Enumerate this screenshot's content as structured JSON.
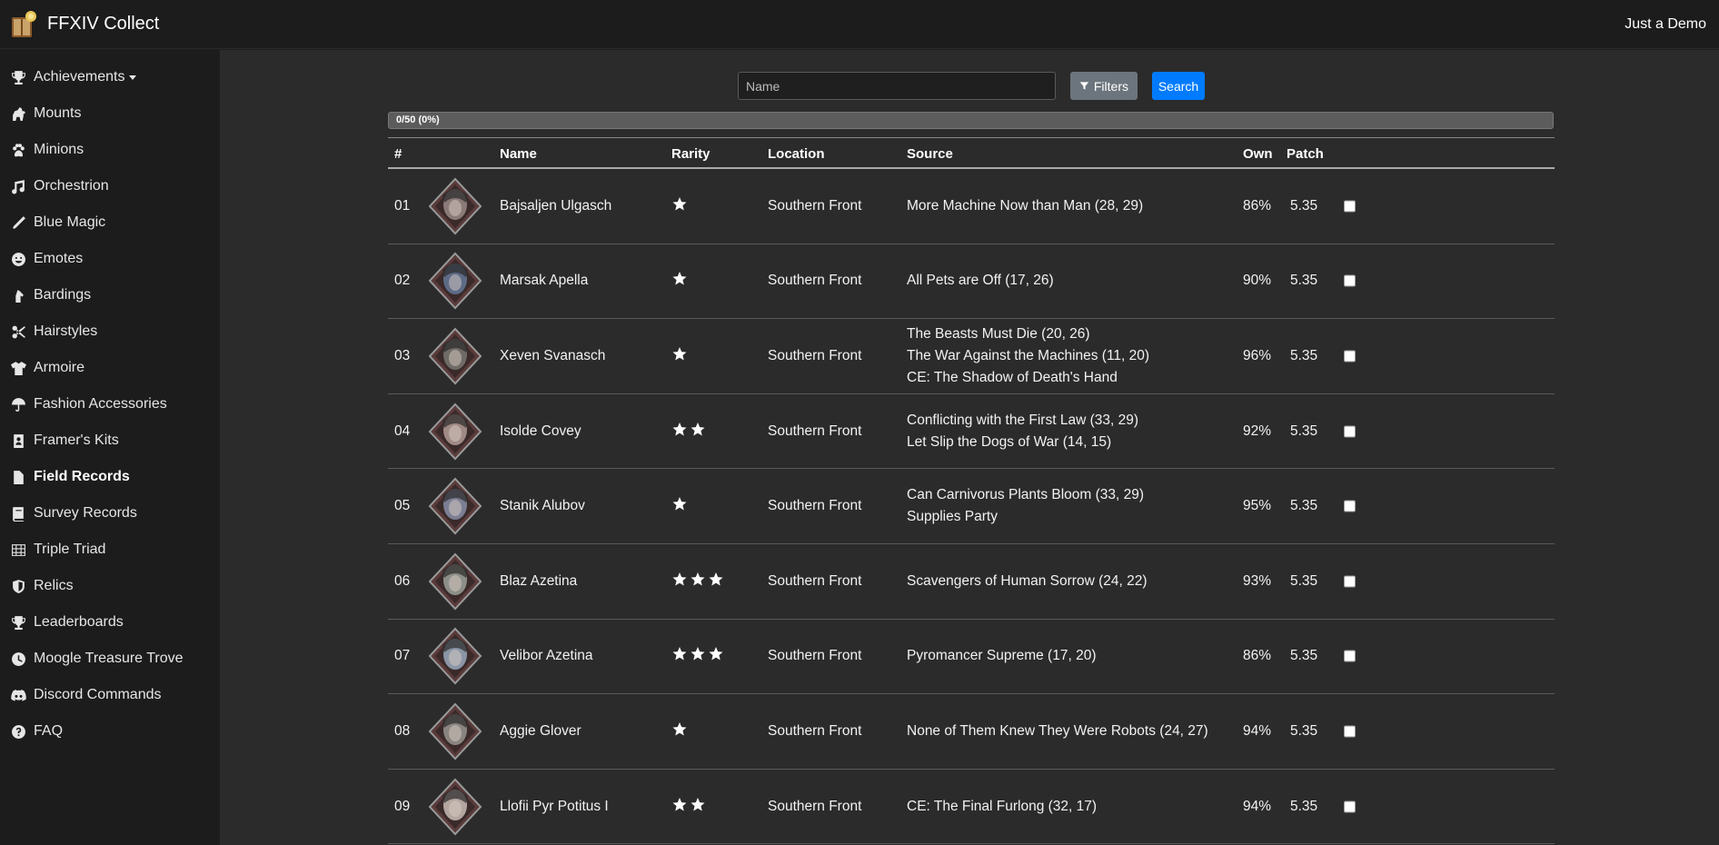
{
  "header": {
    "title": "FFXIV Collect",
    "user_link": "Just a Demo"
  },
  "sidebar": {
    "items": [
      {
        "label": "Achievements",
        "icon": "trophy-icon",
        "dropdown": true
      },
      {
        "label": "Mounts",
        "icon": "horse-icon"
      },
      {
        "label": "Minions",
        "icon": "paw-icon"
      },
      {
        "label": "Orchestrion",
        "icon": "music-icon"
      },
      {
        "label": "Blue Magic",
        "icon": "wand-icon"
      },
      {
        "label": "Emotes",
        "icon": "smile-icon"
      },
      {
        "label": "Bardings",
        "icon": "horse-head-icon"
      },
      {
        "label": "Hairstyles",
        "icon": "scissors-icon"
      },
      {
        "label": "Armoire",
        "icon": "shirt-icon"
      },
      {
        "label": "Fashion Accessories",
        "icon": "umbrella-icon"
      },
      {
        "label": "Framer's Kits",
        "icon": "portrait-icon"
      },
      {
        "label": "Field Records",
        "icon": "file-icon",
        "active": true
      },
      {
        "label": "Survey Records",
        "icon": "book-icon"
      },
      {
        "label": "Triple Triad",
        "icon": "table-icon"
      },
      {
        "label": "Relics",
        "icon": "shield-icon"
      },
      {
        "label": "Leaderboards",
        "icon": "trophy-icon"
      },
      {
        "label": "Moogle Treasure Trove",
        "icon": "clock-icon"
      },
      {
        "label": "Discord Commands",
        "icon": "discord-icon"
      },
      {
        "label": "FAQ",
        "icon": "question-icon"
      }
    ]
  },
  "search": {
    "placeholder": "Name",
    "filters_label": "Filters",
    "search_label": "Search"
  },
  "progress": {
    "text": "0/50 (0%)",
    "fraction": 0
  },
  "table": {
    "headers": {
      "num": "#",
      "name": "Name",
      "rarity": "Rarity",
      "location": "Location",
      "source": "Source",
      "own": "Own",
      "patch": "Patch"
    },
    "rows": [
      {
        "num": "01",
        "name": "Bajsaljen Ulgasch",
        "rarity": 1,
        "location": "Southern Front",
        "source": [
          "More Machine Now than Man (28, 29)"
        ],
        "own": "86%",
        "patch": "5.35",
        "portrait_color": "#8a7a78"
      },
      {
        "num": "02",
        "name": "Marsak Apella",
        "rarity": 1,
        "location": "Southern Front",
        "source": [
          "All Pets are Off (17, 26)"
        ],
        "own": "90%",
        "patch": "5.35",
        "portrait_color": "#5d6b86"
      },
      {
        "num": "03",
        "name": "Xeven Svanasch",
        "rarity": 1,
        "location": "Southern Front",
        "source": [
          "The Beasts Must Die (20, 26)",
          "The War Against the Machines (11, 20)",
          "CE: The Shadow of Death's Hand"
        ],
        "own": "96%",
        "patch": "5.35",
        "portrait_color": "#6f6b66"
      },
      {
        "num": "04",
        "name": "Isolde Covey",
        "rarity": 2,
        "location": "Southern Front",
        "source": [
          "Conflicting with the First Law (33, 29)",
          "Let Slip the Dogs of War (14, 15)"
        ],
        "own": "92%",
        "patch": "5.35",
        "portrait_color": "#a08a86"
      },
      {
        "num": "05",
        "name": "Stanik Alubov",
        "rarity": 1,
        "location": "Southern Front",
        "source": [
          "Can Carnivorus Plants Bloom (33, 29)",
          "Supplies Party"
        ],
        "own": "95%",
        "patch": "5.35",
        "portrait_color": "#7c7f94"
      },
      {
        "num": "06",
        "name": "Blaz Azetina",
        "rarity": 3,
        "location": "Southern Front",
        "source": [
          "Scavengers of Human Sorrow (24, 22)"
        ],
        "own": "93%",
        "patch": "5.35",
        "portrait_color": "#8c8f88"
      },
      {
        "num": "07",
        "name": "Velibor Azetina",
        "rarity": 3,
        "location": "Southern Front",
        "source": [
          "Pyromancer Supreme (17, 20)"
        ],
        "own": "86%",
        "patch": "5.35",
        "portrait_color": "#8b96a6"
      },
      {
        "num": "08",
        "name": "Aggie Glover",
        "rarity": 1,
        "location": "Southern Front",
        "source": [
          "None of Them Knew They Were Robots (24, 27)"
        ],
        "own": "94%",
        "patch": "5.35",
        "portrait_color": "#8a8480"
      },
      {
        "num": "09",
        "name": "Llofii Pyr Potitus I",
        "rarity": 2,
        "location": "Southern Front",
        "source": [
          "CE: The Final Furlong (32, 17)"
        ],
        "own": "94%",
        "patch": "5.35",
        "portrait_color": "#b3a6a0"
      }
    ]
  },
  "colors": {
    "background": "#2b2b2b",
    "sidebar": "#1c1c1c",
    "primary": "#007bff",
    "secondary": "#6c757d"
  }
}
